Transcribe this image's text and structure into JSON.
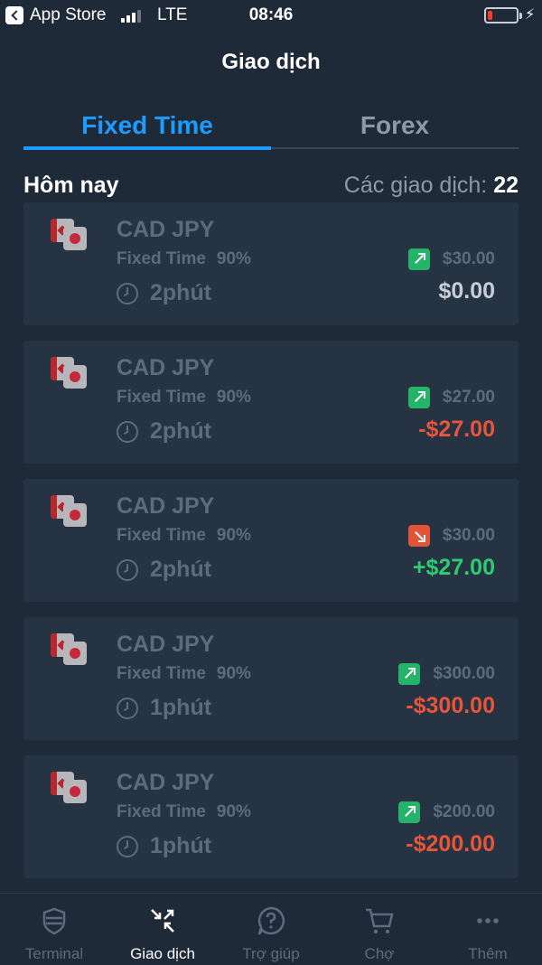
{
  "status_bar": {
    "back_app": "App Store",
    "network": "LTE",
    "time": "08:46",
    "signal_bars": 3,
    "battery_level": 0.15
  },
  "header": {
    "title": "Giao dịch"
  },
  "tabs": [
    {
      "label": "Fixed Time",
      "active": true
    },
    {
      "label": "Forex",
      "active": false
    }
  ],
  "section": {
    "title": "Hôm nay",
    "count_label": "Các giao dịch:",
    "count_value": "22"
  },
  "trades": [
    {
      "pair": "CAD JPY",
      "mode": "Fixed Time",
      "payout": "90%",
      "duration": "2phút",
      "direction": "up",
      "stake": "$30.00",
      "result": "$0.00",
      "result_type": "neutral"
    },
    {
      "pair": "CAD JPY",
      "mode": "Fixed Time",
      "payout": "90%",
      "duration": "2phút",
      "direction": "up",
      "stake": "$27.00",
      "result": "-$27.00",
      "result_type": "loss"
    },
    {
      "pair": "CAD JPY",
      "mode": "Fixed Time",
      "payout": "90%",
      "duration": "2phút",
      "direction": "down",
      "stake": "$30.00",
      "result": "+$27.00",
      "result_type": "win"
    },
    {
      "pair": "CAD JPY",
      "mode": "Fixed Time",
      "payout": "90%",
      "duration": "1phút",
      "direction": "up",
      "stake": "$300.00",
      "result": "-$300.00",
      "result_type": "loss"
    },
    {
      "pair": "CAD JPY",
      "mode": "Fixed Time",
      "payout": "90%",
      "duration": "1phút",
      "direction": "up",
      "stake": "$200.00",
      "result": "-$200.00",
      "result_type": "loss"
    }
  ],
  "bottom_nav": [
    {
      "label": "Terminal",
      "icon": "shield-icon",
      "active": false
    },
    {
      "label": "Giao dịch",
      "icon": "arrows-in-out-icon",
      "active": true
    },
    {
      "label": "Trợ giúp",
      "icon": "help-chat-icon",
      "active": false
    },
    {
      "label": "Chợ",
      "icon": "cart-icon",
      "active": false
    },
    {
      "label": "Thêm",
      "icon": "more-dots-icon",
      "active": false
    }
  ],
  "colors": {
    "background": "#1f2a38",
    "card": "#263342",
    "accent": "#1e9bff",
    "win": "#2ecc71",
    "loss": "#e8553a",
    "muted": "#5d6b7c",
    "up_badge": "#23b46a",
    "down_badge": "#e35339"
  }
}
